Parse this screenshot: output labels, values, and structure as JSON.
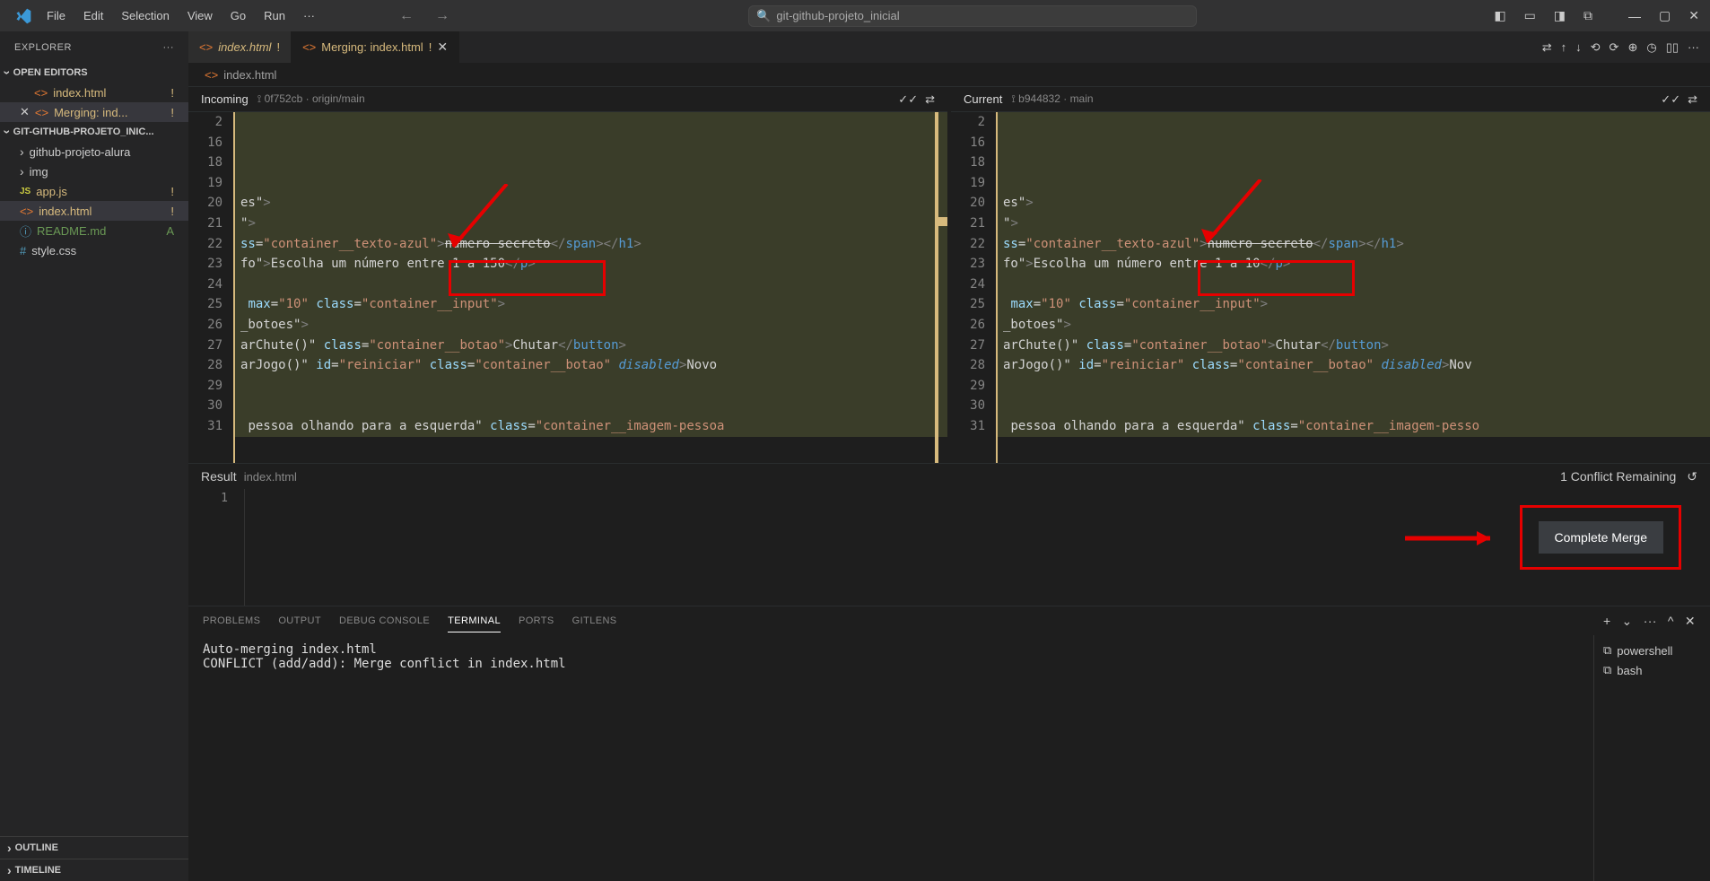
{
  "titlebar": {
    "menu": [
      "File",
      "Edit",
      "Selection",
      "View",
      "Go",
      "Run",
      "···"
    ],
    "search_prefix": "git-github-projeto_inicial"
  },
  "explorer": {
    "title": "EXPLORER",
    "open_editors": "OPEN EDITORS",
    "project": "GIT-GITHUB-PROJETO_INIC...",
    "tabs": [
      {
        "icon": "<>",
        "name": "index.html",
        "badge": "!",
        "status": "modified"
      },
      {
        "icon": "<>",
        "name": "Merging: ind...",
        "badge": "!",
        "status": "modified",
        "close": true
      }
    ],
    "files": [
      {
        "type": "folder",
        "name": "github-projeto-alura"
      },
      {
        "type": "folder",
        "name": "img"
      },
      {
        "type": "file",
        "name": "app.js",
        "prefix": "JS",
        "status": "modified",
        "badge": "!"
      },
      {
        "type": "file",
        "name": "index.html",
        "prefix": "<>",
        "status": "modified",
        "badge": "!"
      },
      {
        "type": "file",
        "name": "README.md",
        "prefix": "ⓘ",
        "status": "added",
        "badge": "A"
      },
      {
        "type": "file",
        "name": "style.css",
        "prefix": "#"
      }
    ],
    "footer": [
      "OUTLINE",
      "TIMELINE"
    ]
  },
  "tabs": {
    "items": [
      {
        "label": "index.html",
        "mod": "!",
        "active": false
      },
      {
        "label": "Merging: index.html",
        "mod": "!",
        "active": true,
        "close": true
      }
    ]
  },
  "breadcrumb": {
    "icon": "<>",
    "name": "index.html"
  },
  "merge": {
    "incoming": {
      "title": "Incoming",
      "commit": "0f752cb",
      "branch": "origin/main"
    },
    "current": {
      "title": "Current",
      "commit": "b944832",
      "branch": "main"
    },
    "line_numbers": [
      "2",
      "16",
      "18",
      "19",
      "20",
      "21",
      "22",
      "23",
      "24",
      "25",
      "26",
      "27",
      "28",
      "29",
      "30",
      "31",
      ""
    ],
    "result_label": "Result",
    "result_file": "index.html",
    "conflicts": "1 Conflict Remaining",
    "complete": "Complete Merge",
    "result_line": "1"
  },
  "terminal": {
    "tabs": [
      "PROBLEMS",
      "OUTPUT",
      "DEBUG CONSOLE",
      "TERMINAL",
      "PORTS",
      "GITLENS"
    ],
    "active": "TERMINAL",
    "output": [
      "Auto-merging index.html",
      "CONFLICT (add/add): Merge conflict in index.html"
    ],
    "shells": [
      "powershell",
      "bash"
    ]
  },
  "chart_data": {
    "type": "diff",
    "incoming_key_line": "fo\">Escolha um número entre 1 a 150</p>",
    "current_key_line": "fo\">Escolha um número entre 1 a 10</p>"
  }
}
